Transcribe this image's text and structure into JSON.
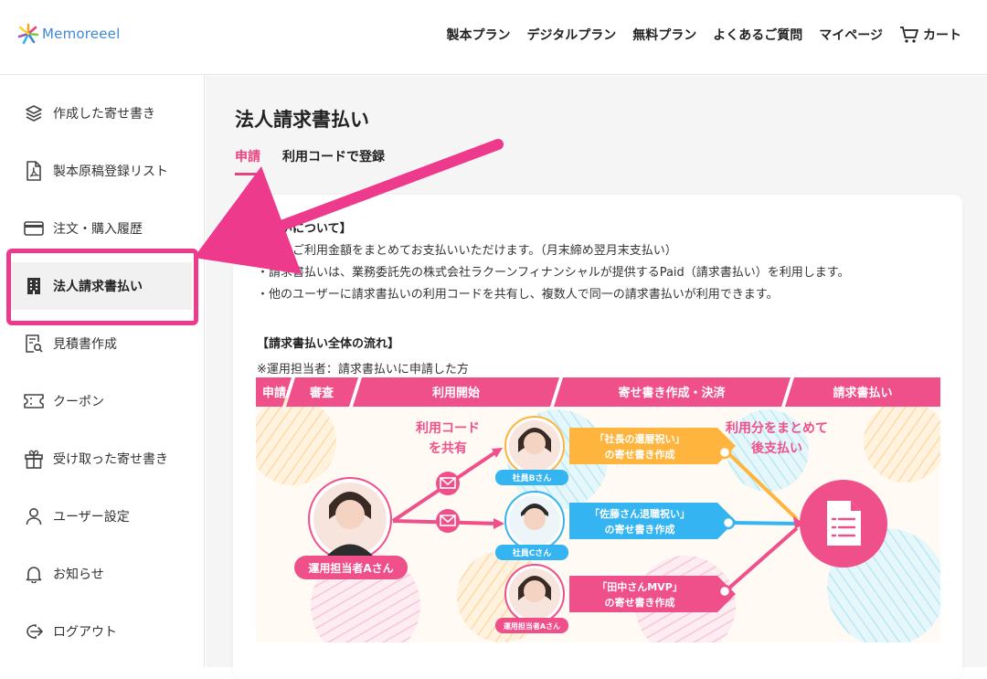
{
  "header": {
    "logo_text": "Memoreeel",
    "nav": [
      {
        "label": "製本プラン"
      },
      {
        "label": "デジタルプラン"
      },
      {
        "label": "無料プラン"
      },
      {
        "label": "よくあるご質問"
      },
      {
        "label": "マイページ"
      }
    ],
    "cart_label": "カート"
  },
  "sidebar": {
    "items": [
      {
        "label": "作成した寄せ書き",
        "icon": "layers-icon"
      },
      {
        "label": "製本原稿登録リスト",
        "icon": "pdf-file-icon"
      },
      {
        "label": "注文・購入履歴",
        "icon": "credit-card-icon"
      },
      {
        "label": "法人請求書払い",
        "icon": "building-icon"
      },
      {
        "label": "見積書作成",
        "icon": "document-search-icon"
      },
      {
        "label": "クーポン",
        "icon": "ticket-icon"
      },
      {
        "label": "受け取った寄せ書き",
        "icon": "gift-icon"
      },
      {
        "label": "ユーザー設定",
        "icon": "user-icon"
      },
      {
        "label": "お知らせ",
        "icon": "bell-icon"
      },
      {
        "label": "ログアウト",
        "icon": "logout-icon"
      }
    ],
    "active_index": 3
  },
  "main": {
    "page_title": "法人請求書払い",
    "tabs": [
      {
        "label": "申請",
        "active": true
      },
      {
        "label": "利用コードで登録",
        "active": false
      }
    ],
    "about": {
      "title": "書払いについて】",
      "lines": [
        "月分のご利用金額をまとめてお支払いいただけます。（月末締め翌月末支払い）",
        "・請求書払いは、業務委託先の株式会社ラクーンフィナンシャルが提供するPaid（請求書払い）を利用します。",
        "・他のユーザーに請求書払いの利用コードを共有し、複数人で同一の請求書払いが利用できます。"
      ]
    },
    "flow": {
      "title": "【請求書払い全体の流れ】",
      "note": "※運用担当者：請求書払いに申請した方",
      "steps": [
        "申請",
        "審査",
        "利用開始",
        "寄せ書き作成・決済",
        "請求書払い"
      ],
      "share_code_line1": "利用コード",
      "share_code_line2": "を共有",
      "combine_line1": "利用分をまとめて",
      "combine_line2": "後支払い",
      "admin_label": "運用担当者Aさん",
      "members": [
        {
          "badge": "社員Bさん",
          "line1": "「社長の還暦祝い」",
          "line2": "の寄せ書き作成",
          "color": "#ffb53d"
        },
        {
          "badge": "社員Cさん",
          "line1": "「佐藤さん退職祝い」",
          "line2": "の寄せ書き作成",
          "color": "#35b4f2"
        },
        {
          "badge": "運用担当者Aさん",
          "line1": "「田中さんMVP」",
          "line2": "の寄せ書き作成",
          "color": "#f0508a"
        }
      ]
    }
  },
  "colors": {
    "accent_pink": "#e8437f",
    "annotation_pink": "#ee3a8c",
    "brand_blue": "#3f88d6"
  }
}
